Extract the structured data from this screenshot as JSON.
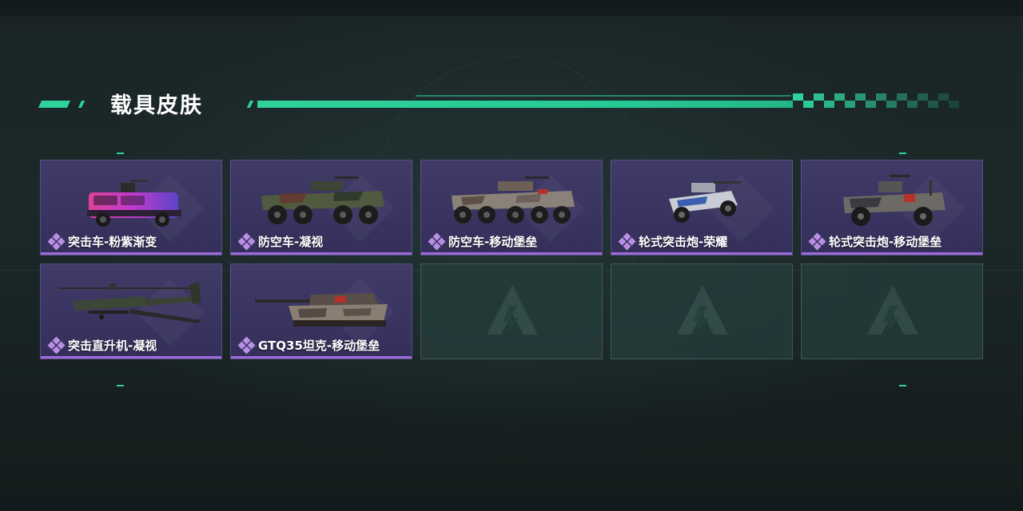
{
  "page": {
    "title": "载具皮肤"
  },
  "colors": {
    "accent_green": "#2fd39a",
    "tile_purple": "#3a3460",
    "rarity_bar": "#9b6bdc",
    "empty_tile": "#263e3c"
  },
  "skins": [
    {
      "name": "突击车-粉紫渐变",
      "icon": "assault-car-icon",
      "rarity_icon": "purple-gem-icon"
    },
    {
      "name": "防空车-凝视",
      "icon": "anti-air-vehicle-icon",
      "rarity_icon": "purple-gem-icon"
    },
    {
      "name": "防空车-移动堡垒",
      "icon": "anti-air-vehicle-icon",
      "rarity_icon": "purple-gem-icon"
    },
    {
      "name": "轮式突击炮-荣耀",
      "icon": "wheeled-assault-gun-icon",
      "rarity_icon": "purple-gem-icon"
    },
    {
      "name": "轮式突击炮-移动堡垒",
      "icon": "wheeled-assault-gun-icon",
      "rarity_icon": "purple-gem-icon"
    },
    {
      "name": "突击直升机-凝视",
      "icon": "attack-helicopter-icon",
      "rarity_icon": "purple-gem-icon"
    },
    {
      "name": "GTQ35坦克-移动堡垒",
      "icon": "tank-icon",
      "rarity_icon": "purple-gem-icon"
    }
  ],
  "empty_slots": [
    {
      "icon": "game-logo-placeholder-icon"
    },
    {
      "icon": "game-logo-placeholder-icon"
    },
    {
      "icon": "game-logo-placeholder-icon"
    }
  ]
}
